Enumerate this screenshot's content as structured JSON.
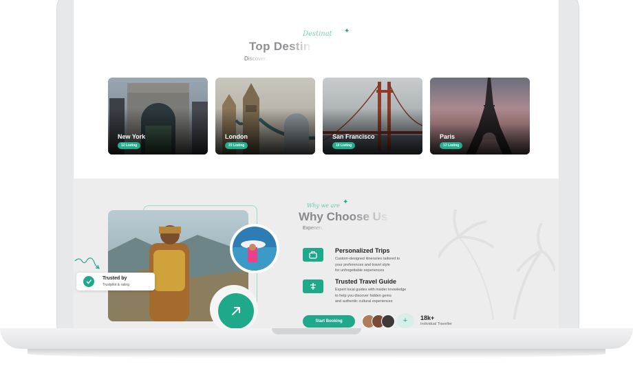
{
  "top_destinations": {
    "script_label": "Destinat",
    "title": "Top Destin",
    "subtitle": "D",
    "subtitle_faded": "iscover..."
  },
  "destinations": [
    {
      "city": "New York",
      "listing": "12 Listing"
    },
    {
      "city": "London",
      "listing": "22 Listing"
    },
    {
      "city": "San Francisco",
      "listing": "10 Listing"
    },
    {
      "city": "Paris",
      "listing": "12 Listing"
    }
  ],
  "why_choose": {
    "script_label": "Why we are",
    "title": "Why Choose Us",
    "subtitle": "Experien..."
  },
  "trust_badge": {
    "title": "Trusted by",
    "subtitle": "Trustpilot & rating"
  },
  "features": [
    {
      "title": "Personalized Trips",
      "icon": "suitcase-icon",
      "lines": [
        "Custom-designed itineraries tailored to",
        "your preferences and travel style",
        "for unforgettable experiences"
      ]
    },
    {
      "title": "Trusted Travel Guide",
      "icon": "signpost-icon",
      "lines": [
        "Expert local guides with insider knowledge",
        "to help you discover hidden gems",
        "and authentic cultural experiences"
      ]
    }
  ],
  "cta": {
    "button_label": "Start Booking",
    "plus_label": "+",
    "count": "18k+",
    "count_label": "Individual Traveller"
  },
  "colors": {
    "accent": "#1fa88a",
    "section_bg": "#ededee"
  }
}
